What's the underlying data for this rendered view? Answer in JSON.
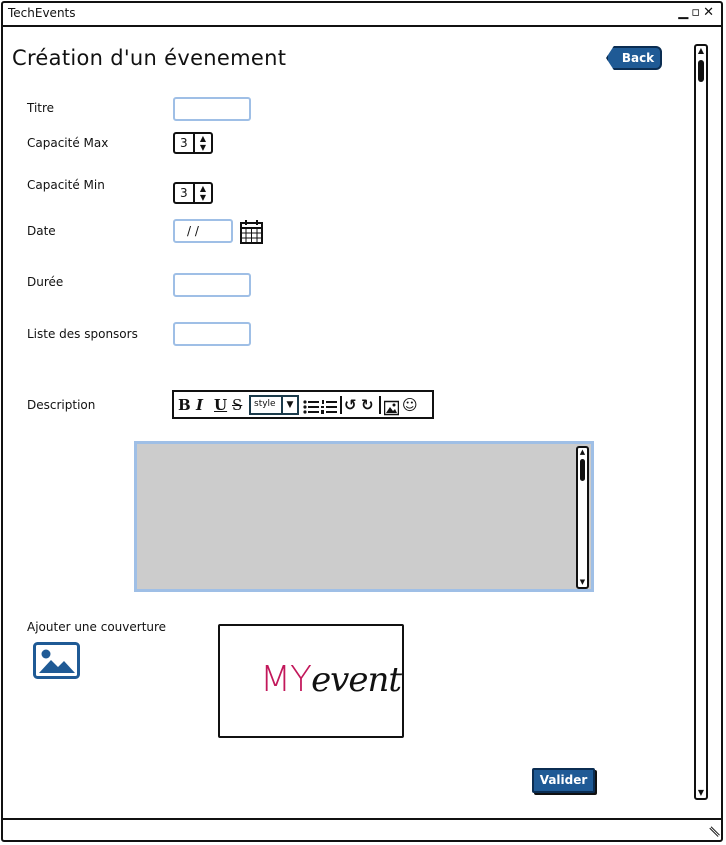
{
  "window": {
    "title": "TechEvents",
    "controls": [
      "▁",
      "◘",
      "✕"
    ]
  },
  "page": {
    "title": "Création d'un évenement",
    "back_label": "Back"
  },
  "form": {
    "titre_label": "Titre",
    "capacite_max_label": "Capacité Max",
    "capacite_max_value": "3",
    "capacite_min_label": "Capacité Min",
    "capacite_min_value": "3",
    "date_label": "Date",
    "date_value": "/ /",
    "duree_label": "Durée",
    "sponsors_label": "Liste des sponsors",
    "description_label": "Description",
    "couverture_label": "Ajouter une couverture",
    "valider_label": "Valider"
  },
  "editor_toolbar": {
    "bold": "B",
    "italic": "I",
    "underline": "U",
    "strike": "S",
    "style_value": "style",
    "icons": [
      "bulleted-list-icon",
      "numbered-list-icon",
      "undo-icon",
      "redo-icon",
      "insert-image-icon",
      "emoji-icon"
    ]
  },
  "cover_preview": {
    "logo_part1": "MY",
    "logo_part2": "event"
  },
  "colors": {
    "accent": "#1f5a95",
    "field_border": "#9fbfe6",
    "textarea_bg": "#cccccc",
    "logo_red": "#c2185b"
  }
}
